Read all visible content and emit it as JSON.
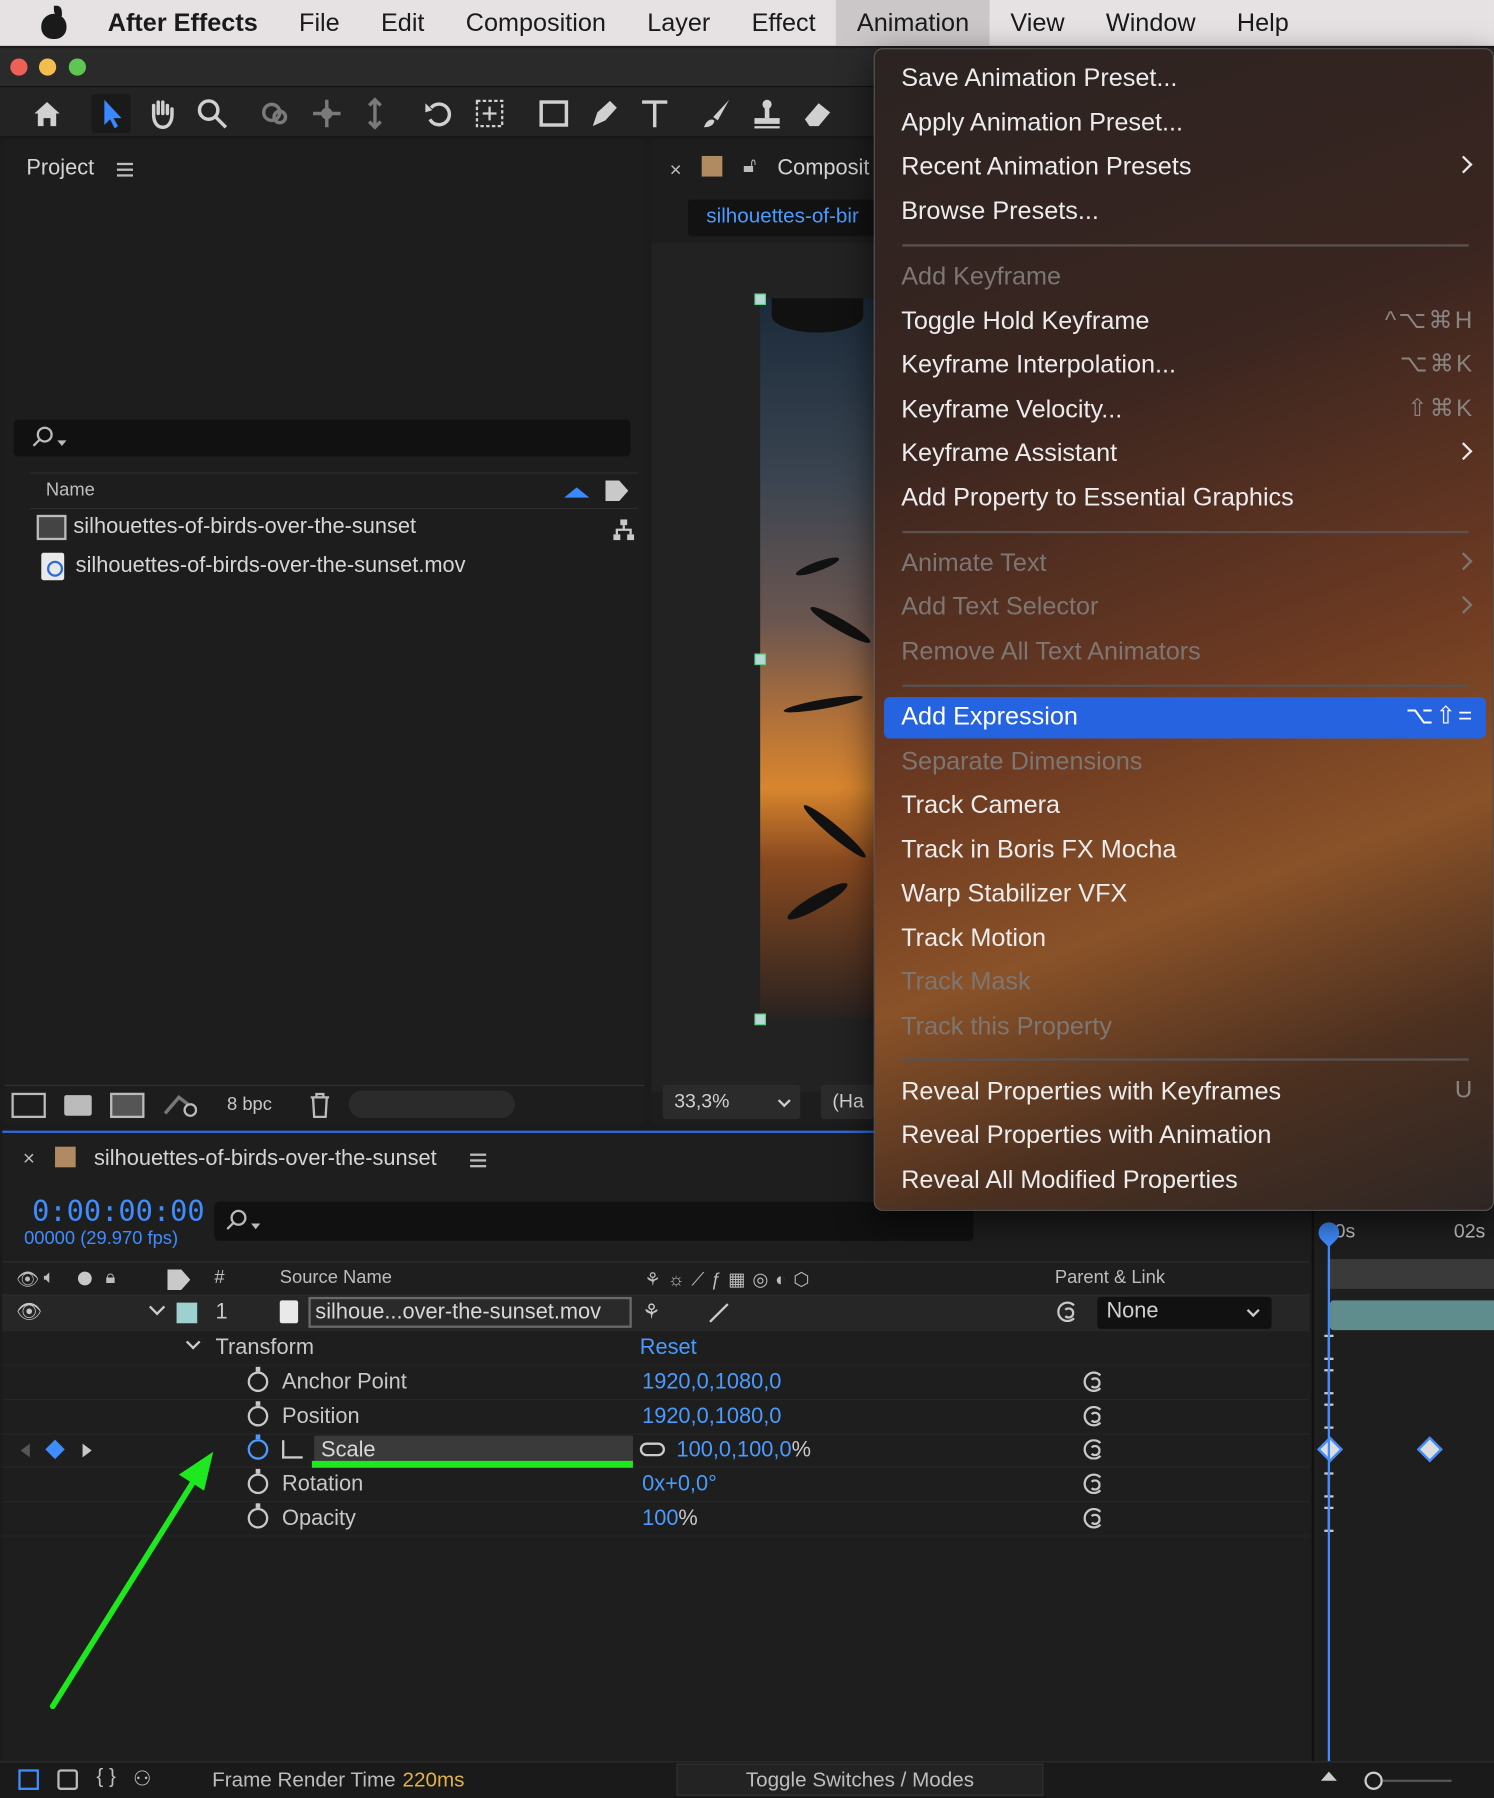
{
  "menubar": {
    "app": "After Effects",
    "items": [
      "File",
      "Edit",
      "Composition",
      "Layer",
      "Effect",
      "Animation",
      "View",
      "Window",
      "Help"
    ]
  },
  "project": {
    "title": "Project",
    "column_name": "Name",
    "items": [
      {
        "name": "silhouettes-of-birds-over-the-sunset",
        "icon": "composition-icon"
      },
      {
        "name": "silhouettes-of-birds-over-the-sunset.mov",
        "icon": "movie-file-icon"
      }
    ],
    "bpc": "8 bpc"
  },
  "composition": {
    "tab": "Composit",
    "crumb": "silhouettes-of-bir",
    "zoom": "33,3%",
    "resolution": "(Ha"
  },
  "timeline": {
    "comp_name": "silhouettes-of-birds-over-the-sunset",
    "timecode": "0:00:00:00",
    "fps": "00000 (29.970 fps)",
    "headers": {
      "num": "#",
      "source": "Source Name",
      "parent": "Parent & Link"
    },
    "layer": {
      "index": "1",
      "name": "silhoue...over-the-sunset.mov",
      "parent": "None"
    },
    "transform": {
      "label": "Transform",
      "reset": "Reset"
    },
    "properties": [
      {
        "name": "Anchor Point",
        "value": "1920,0,1080,0",
        "suffix": ""
      },
      {
        "name": "Position",
        "value": "1920,0,1080,0",
        "suffix": ""
      },
      {
        "name": "Scale",
        "value": "100,0,100,0",
        "suffix": "%"
      },
      {
        "name": "Rotation",
        "value": "0x+0,0°",
        "suffix": ""
      },
      {
        "name": "Opacity",
        "value": "100",
        "suffix": "%"
      }
    ],
    "ruler": {
      "start": "0s",
      "mark": "02s"
    }
  },
  "statusbar": {
    "frame_render_label": "Frame Render Time",
    "frame_render_value": "220ms",
    "toggle": "Toggle Switches / Modes"
  },
  "animation_menu": {
    "items": [
      {
        "label": "Save Animation Preset...",
        "disabled": false
      },
      {
        "label": "Apply Animation Preset...",
        "disabled": false
      },
      {
        "label": "Recent Animation Presets",
        "disabled": false,
        "submenu": true
      },
      {
        "label": "Browse Presets...",
        "disabled": false
      },
      {
        "label": "Add Keyframe",
        "disabled": true
      },
      {
        "label": "Toggle Hold Keyframe",
        "disabled": false,
        "shortcut": "^⌥⌘H"
      },
      {
        "label": "Keyframe Interpolation...",
        "disabled": false,
        "shortcut": "⌥⌘K"
      },
      {
        "label": "Keyframe Velocity...",
        "disabled": false,
        "shortcut": "⇧⌘K"
      },
      {
        "label": "Keyframe Assistant",
        "disabled": false,
        "submenu": true
      },
      {
        "label": "Add Property to Essential Graphics",
        "disabled": false
      },
      {
        "label": "Animate Text",
        "disabled": true,
        "submenu": true
      },
      {
        "label": "Add Text Selector",
        "disabled": true,
        "submenu": true
      },
      {
        "label": "Remove All Text Animators",
        "disabled": true
      },
      {
        "label": "Add Expression",
        "disabled": false,
        "highlighted": true,
        "shortcut": "⌥⇧="
      },
      {
        "label": "Separate Dimensions",
        "disabled": true
      },
      {
        "label": "Track Camera",
        "disabled": false
      },
      {
        "label": "Track in Boris FX Mocha",
        "disabled": false
      },
      {
        "label": "Warp Stabilizer VFX",
        "disabled": false
      },
      {
        "label": "Track Motion",
        "disabled": false
      },
      {
        "label": "Track Mask",
        "disabled": true
      },
      {
        "label": "Track this Property",
        "disabled": true
      },
      {
        "label": "Reveal Properties with Keyframes",
        "disabled": false,
        "shortcut": "U"
      },
      {
        "label": "Reveal Properties with Animation",
        "disabled": false
      },
      {
        "label": "Reveal All Modified Properties",
        "disabled": false
      }
    ]
  },
  "colors": {
    "accent": "#2563e0",
    "timecode": "#3f8cff",
    "annotation_arrow": "#1ee81e",
    "render_time": "#e2b14a"
  }
}
